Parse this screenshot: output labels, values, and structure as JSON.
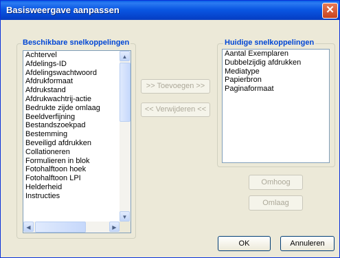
{
  "window": {
    "title": "Basisweergave aanpassen",
    "close_glyph": "✕"
  },
  "available": {
    "label": "Beschikbare snelkoppelingen",
    "items": [
      "Achtervel",
      "Afdelings-ID",
      "Afdelingswachtwoord",
      "Afdrukformaat",
      "Afdrukstand",
      "Afdrukwachtrij-actie",
      "Bedrukte zijde omlaag",
      "Beeldverfijning",
      "Bestandszoekpad",
      "Bestemming",
      "Beveiligd afdrukken",
      "Collationeren",
      "Formulieren in blok",
      "Fotohalftoon hoek",
      "Fotohalftoon LPI",
      "Helderheid",
      "Instructies"
    ]
  },
  "current": {
    "label": "Huidige snelkoppelingen",
    "items": [
      "Aantal Exemplaren",
      "Dubbelzijdig afdrukken",
      "Mediatype",
      "Papierbron",
      "Paginaformaat"
    ]
  },
  "buttons": {
    "add": ">> Toevoegen >>",
    "remove": "<< Verwijderen <<",
    "up": "Omhoog",
    "down": "Omlaag",
    "ok": "OK",
    "cancel": "Annuleren"
  },
  "icons": {
    "scroll_up": "▲",
    "scroll_down": "▼",
    "scroll_left": "◀",
    "scroll_right": "▶"
  },
  "colors": {
    "title_bar": "#0a57e3",
    "group_label": "#0046d5",
    "window_bg": "#ece9d8"
  }
}
